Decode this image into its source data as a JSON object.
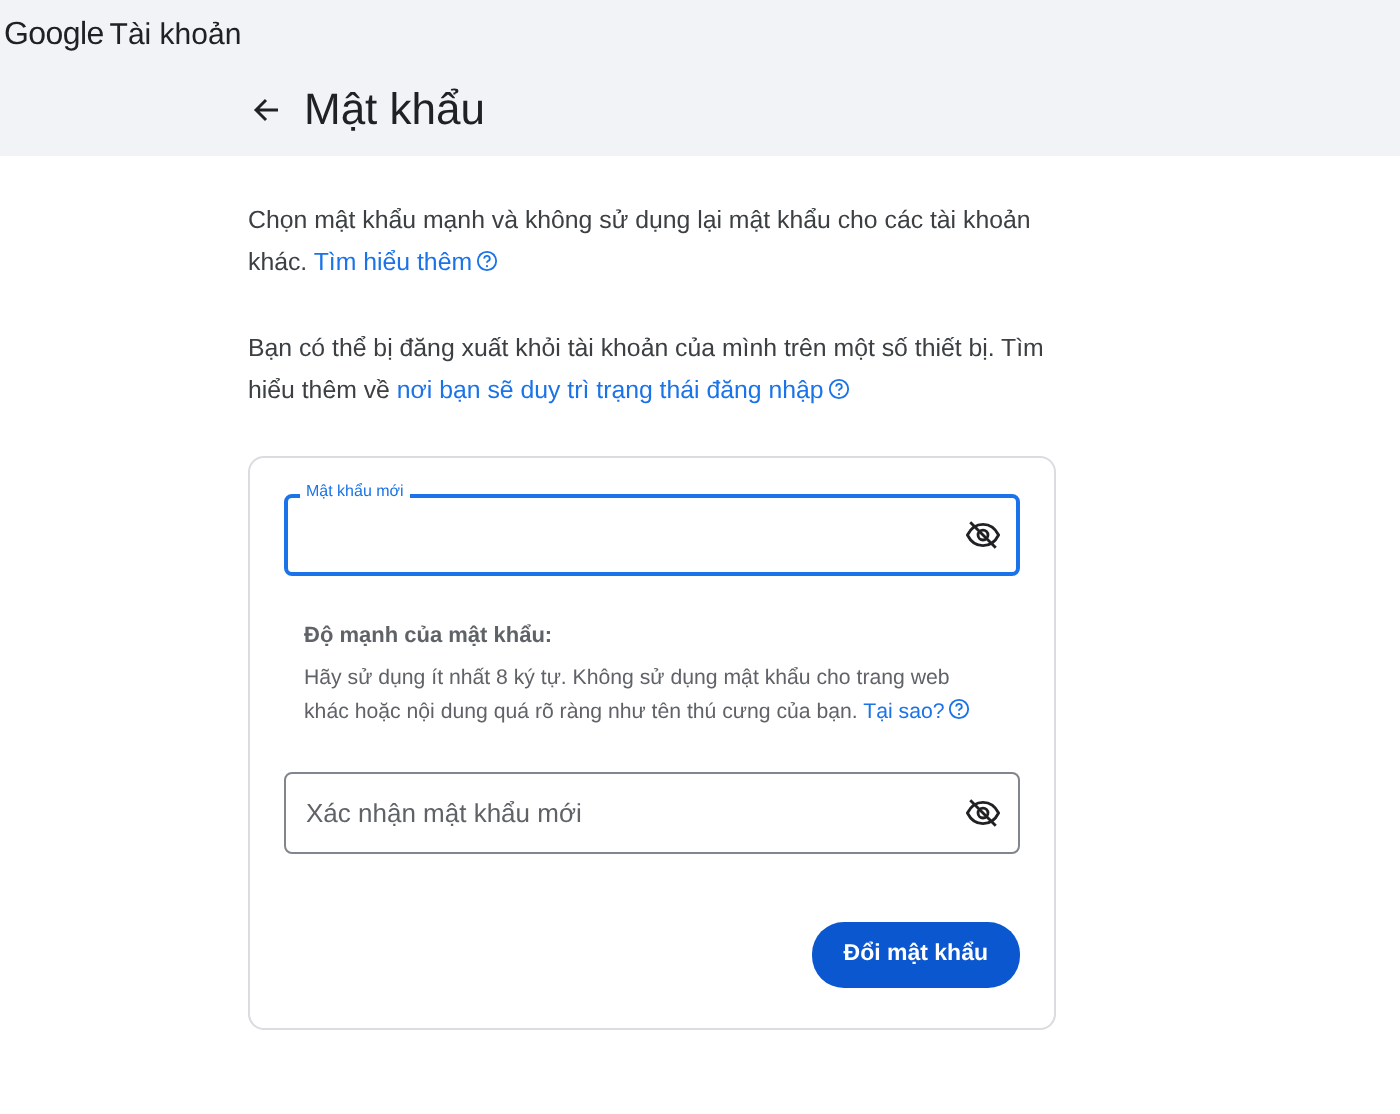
{
  "header": {
    "logo": "Google",
    "product": "Tài khoản"
  },
  "page": {
    "title": "Mật khẩu"
  },
  "paragraphs": [
    {
      "text": "Chọn mật khẩu mạnh và không sử dụng lại mật khẩu cho các tài khoản khác.",
      "link": "Tìm hiểu thêm"
    },
    {
      "text": "Bạn có thể bị đăng xuất khỏi tài khoản của mình trên một số thiết bị. Tìm hiểu thêm về",
      "link": "nơi bạn sẽ duy trì trạng thái đăng nhập"
    }
  ],
  "form": {
    "new_password": {
      "label": "Mật khẩu mới",
      "focused": true
    },
    "strength": {
      "title": "Độ mạnh của mật khẩu:",
      "hint": "Hãy sử dụng ít nhất 8 ký tự. Không sử dụng mật khẩu cho trang web khác hoặc nội dung quá rõ ràng như tên thú cưng của bạn.",
      "link": "Tại sao?"
    },
    "confirm_password": {
      "placeholder": "Xác nhận mật khẩu mới",
      "focused": false
    },
    "submit": "Đổi mật khẩu"
  }
}
